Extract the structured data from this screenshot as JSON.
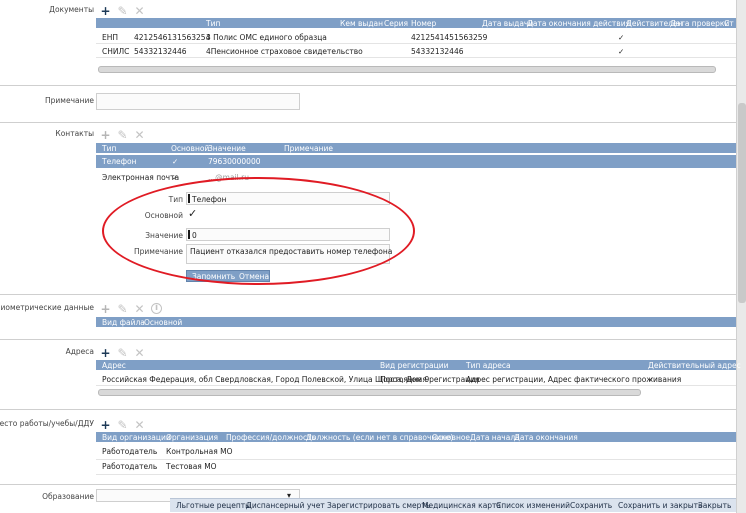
{
  "documents": {
    "label": "Документы",
    "columns": [
      "Тип",
      "Кем выдан",
      "Серия",
      "Номер",
      "Дата выдачи",
      "Дата окончания действия",
      "Действителен",
      "Дата проверки",
      "Ст"
    ],
    "rows": [
      {
        "code": "ЕНП",
        "value": "4212546131563254",
        "type": "3 Полис ОМС единого образца",
        "number": "4212541451563259",
        "valid": "✓"
      },
      {
        "code": "СНИЛС",
        "value": "54332132446",
        "type": "4Пенсионное страховое свидетельство",
        "number": "54332132446",
        "valid": "✓"
      }
    ]
  },
  "note": {
    "label": "Примечание"
  },
  "contacts": {
    "label": "Контакты",
    "columns": [
      "Тип",
      "Основной",
      "Значение",
      "Примечание"
    ],
    "rows": [
      {
        "type": "Телефон",
        "main": "✓",
        "value": "79630000000"
      },
      {
        "type": "Электронная почта",
        "main": "✓",
        "value": "...@mail.ru"
      }
    ],
    "form": {
      "type_label": "Тип",
      "type_value": "Телефон",
      "main_label": "Основной",
      "main_check": "✓",
      "value_label": "Значение",
      "value_value": "0",
      "note_label": "Примечание",
      "note_value": "Пациент отказался предоставить номер телефона",
      "save": "Запомнить",
      "cancel": "Отмена"
    }
  },
  "biometrics": {
    "label": "Биометрические данные",
    "columns": [
      "Вид файла",
      "Основной"
    ]
  },
  "addresses": {
    "label": "Адреса",
    "columns": [
      "Адрес",
      "Вид регистрации",
      "Тип адреса",
      "Действительный адрес"
    ],
    "rows": [
      {
        "address": "Российская Федерация, обл Свердловская, Город Полевской, Улица Щорса, Дом 9",
        "reg": "Постоянная регистрация",
        "type": "Адрес регистрации, Адрес фактического проживания",
        "valid": "✓"
      }
    ]
  },
  "work": {
    "label": "Место работы/учебы/ДДУ",
    "columns": [
      "Вид организации",
      "Организация",
      "Профессия/должность",
      "Должность (если нет в справочнике)",
      "Основное",
      "Дата начала",
      "Дата окончания"
    ],
    "rows": [
      {
        "kind": "Работодатель",
        "org": "Контрольная МО"
      },
      {
        "kind": "Работодатель",
        "org": "Тестовая МО"
      }
    ]
  },
  "education": {
    "label": "Образование"
  },
  "bottom_bar": [
    "Льготные рецепты",
    "Диспансерный учет",
    "Зарегистрировать смерть",
    "Медицинская карта",
    "Список изменений",
    "Сохранить",
    "Сохранить и закрыть",
    "Закрыть"
  ]
}
